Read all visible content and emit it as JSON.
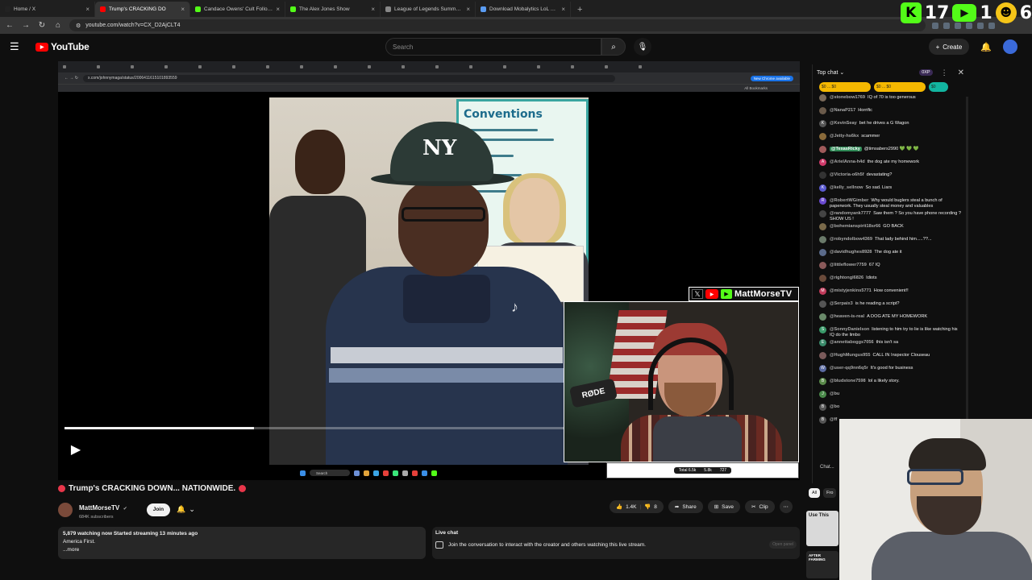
{
  "browser": {
    "tabs": [
      {
        "title": "Home / X",
        "color": "#222222"
      },
      {
        "title": "Trump's CRACKING DO",
        "color": "#ff0000",
        "active": true
      },
      {
        "title": "Candace Owens' Cult Followers",
        "color": "#53fc18"
      },
      {
        "title": "The Alex Jones Show",
        "color": "#53fc18"
      },
      {
        "title": "League of Legends Summoner",
        "color": "#888888"
      },
      {
        "title": "Download Mobalytics LoL Desk",
        "color": "#5a9cf2"
      }
    ],
    "url": "youtube.com/watch?v=CX_D2AjCLT4"
  },
  "overlay": {
    "kick_letter": "K",
    "count_a": "17",
    "count_b": "1",
    "count_c": "6"
  },
  "header": {
    "logo_text": "YouTube",
    "search_placeholder": "Search",
    "create_label": "Create"
  },
  "player": {
    "inner_url": "x.com/johnnymaga/status/2006411615101893559",
    "inner_new_chrome": "New Chrome available",
    "inner_bookmarks": "All Bookmarks",
    "poster_title": "Conventions",
    "tiktok_glyph": "♪",
    "progress": 0.26,
    "taskbar_search": "Search"
  },
  "webcam": {
    "channel_label": "MattMorseTV",
    "mic_brand": "RØDE",
    "stat_a": "Total 6.5k",
    "stat_b": "5.8k",
    "stat_c": "727"
  },
  "video": {
    "title": "Trump's CRACKING DOWN... NATIONWIDE.",
    "channel_name": "MattMorseTV",
    "subscribers": "684K subscribers",
    "join_label": "Join",
    "likes": "1.4K",
    "dislikes": "8",
    "share_label": "Share",
    "save_label": "Save",
    "clip_label": "Clip",
    "desc_stats": "5,879 watching now  Started streaming 13 minutes ago",
    "desc_line": "America First.",
    "desc_more": "...more",
    "livechat_title": "Live chat",
    "livechat_text": "Join the conversation to interact with the creator and others watching this live stream.",
    "livechat_open": "Open panel"
  },
  "chat": {
    "mode_label": "Top chat",
    "xp_label": "0XP",
    "ticker": [
      {
        "text": "$0 ... $0",
        "style": ""
      },
      {
        "text": "$0 ... $0",
        "style": ""
      },
      {
        "text": "$0",
        "style": "teal"
      }
    ],
    "messages": [
      {
        "author": "@stonebow1769",
        "text": "IQ of 70 is too generous",
        "color": "#7a6a5a"
      },
      {
        "author": "@NanaP217",
        "text": "Horrific",
        "color": "#6a5a4a"
      },
      {
        "author": "@KevinSeay",
        "text": "bet he drives a G Wagon",
        "color": "#555555",
        "initial": "K"
      },
      {
        "author": "@Jetty-hs6kx",
        "text": "scammer",
        "color": "#8a6a3a"
      },
      {
        "author": "@TexasRicky",
        "text": "@timsabers2990 💚 💚 💚",
        "color": "#a05a5a",
        "highlight": true
      },
      {
        "author": "@ArielAnna-h4d",
        "text": "the dog ate my homework",
        "color": "#d03a6a",
        "initial": "A"
      },
      {
        "author": "@Victoria-o6h5f",
        "text": "devastating?",
        "color": "#333333"
      },
      {
        "author": "@kelly_sellnow",
        "text": "So sad. Liars",
        "color": "#5a5ad0",
        "initial": "K"
      },
      {
        "author": "@RobertWGimber",
        "text": "Why would buglers steal a bunch of paperwork. They usually steal money and valuables",
        "color": "#6a4ad0",
        "initial": "R"
      },
      {
        "author": "@randomyank7777",
        "text": "Saw them ? So you have phone recording ? SHOW US !",
        "color": "#444444"
      },
      {
        "author": "@bohemianspirit18sr66",
        "text": "GO BACK",
        "color": "#7a6a4a"
      },
      {
        "author": "@robyndolbow4369",
        "text": "That lady behind him.....??...",
        "color": "#6a7a6a"
      },
      {
        "author": "@davidhughes8928",
        "text": "The dog ate it",
        "color": "#5a6a8a"
      },
      {
        "author": "@littleflower7759",
        "text": "67 IQ",
        "color": "#8a5a5a"
      },
      {
        "author": "@rightongl6826",
        "text": "Idiots",
        "color": "#6a4a3a"
      },
      {
        "author": "@mistyjenkins5771",
        "text": "How convenient!!",
        "color": "#c03a5a",
        "initial": "M"
      },
      {
        "author": "@Serpaix3",
        "text": "is he reading a script?",
        "color": "#555555"
      },
      {
        "author": "@heaven-is-real",
        "text": "A DOG ATE MY HOMEWORK",
        "color": "#6a8a6a"
      },
      {
        "author": "@SonnyDanielson",
        "text": "listening to him try to lie is like watching his IQ do the limbo",
        "color": "#3a9a6a",
        "initial": "S"
      },
      {
        "author": "@annettaboggs7056",
        "text": "this isn't sa",
        "color": "#3a8a6a",
        "initial": "E"
      },
      {
        "author": "@HughMungus955",
        "text": "CALL IN Inspector Clouseau",
        "color": "#7a5a5a"
      },
      {
        "author": "@user-qq9nn6q5r",
        "text": "It's good for business",
        "color": "#5a6aa0",
        "initial": "W"
      },
      {
        "author": "@bludstone7598",
        "text": "lol a likely story.",
        "color": "#5a8a4a",
        "initial": "B"
      },
      {
        "author": "@bu",
        "text": "",
        "color": "#4a8a4a",
        "initial": "J"
      },
      {
        "author": "@bo",
        "text": "",
        "color": "#555555",
        "initial": "B"
      },
      {
        "author": "@ff",
        "text": "",
        "color": "#555555",
        "initial": "B"
      }
    ],
    "chat_stub": "Chat...",
    "tab_all": "All",
    "tab_from": "Fro",
    "rec_card_text": "Use This",
    "rec_card2_text": "AFTER FARMING"
  }
}
